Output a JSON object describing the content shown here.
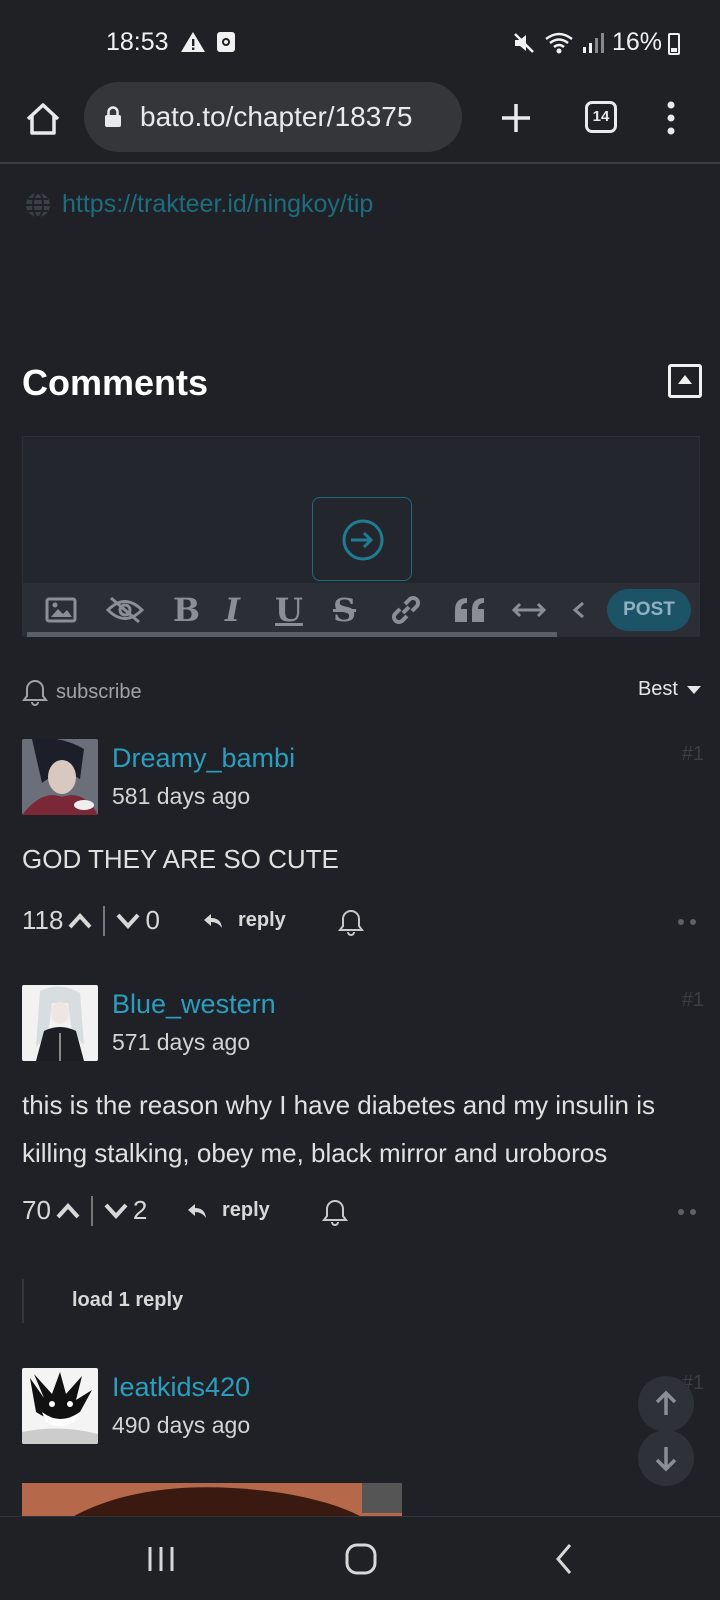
{
  "status_bar": {
    "time": "18:53",
    "battery": "16%",
    "icons": [
      "warning-icon",
      "screenshot-icon",
      "mute-icon",
      "wifi-icon",
      "signal-icon",
      "battery-icon"
    ]
  },
  "browser": {
    "url": "bato.to/chapter/18375",
    "tab_count": "14"
  },
  "credits": {
    "tip_link": "https://trakteer.id/ningkoy/tip"
  },
  "comments": {
    "title": "Comments",
    "post_label": "POST",
    "subscribe_label": "subscribe",
    "sort_label": "Best",
    "reply_label": "reply",
    "items": [
      {
        "username": "Dreamy_bambi",
        "time_ago": "581 days ago",
        "number": "#1",
        "text": "GOD THEY ARE SO CUTE",
        "upvotes": "118",
        "downvotes": "0"
      },
      {
        "username": "Blue_western",
        "time_ago": "571 days ago",
        "number": "#1",
        "text": "this is the reason why I have diabetes and my insulin is killing stalking, obey me, black mirror and uroboros",
        "upvotes": "70",
        "downvotes": "2",
        "load_replies": "load 1 reply"
      },
      {
        "username": "Ieatkids420",
        "time_ago": "490 days ago",
        "number": "#1"
      }
    ]
  },
  "colors": {
    "background": "#1f2126",
    "link": "#2b9ec0",
    "accent": "#1d5367"
  }
}
